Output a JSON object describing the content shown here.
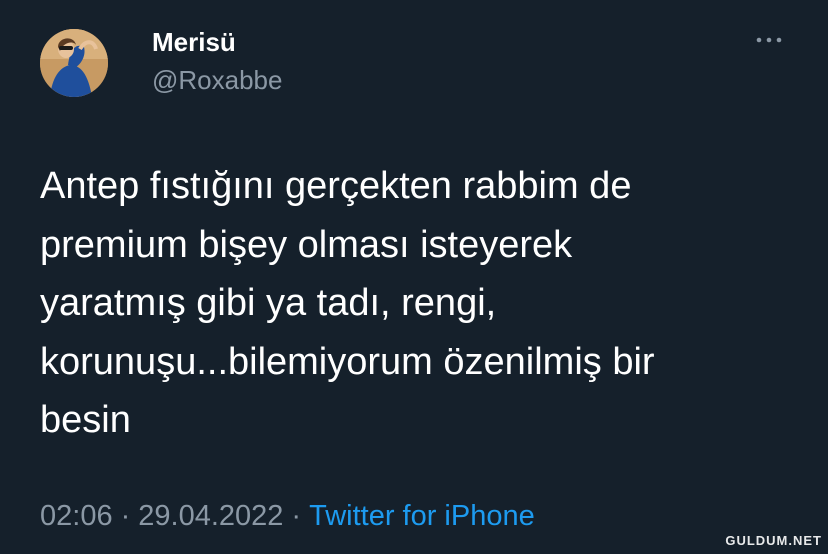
{
  "user": {
    "display_name": "Merisü",
    "username": "@Roxabbe"
  },
  "tweet": {
    "text": "Antep fıstığını gerçekten rabbim de\npremium bişey olması isteyerek\nyaratmış gibi ya tadı, rengi,\nkorunuşu...bilemiyorum özenilmiş bir\nbesin",
    "time": "02:06",
    "date": "29.04.2022",
    "separator": "·",
    "source": "Twitter for iPhone"
  },
  "icons": {
    "more": "more-horizontal-icon",
    "avatar": "profile-photo"
  },
  "colors": {
    "background": "#15202b",
    "primary_text": "#ffffff",
    "secondary_text": "#8b98a5",
    "link": "#1d9bf0"
  },
  "watermark": "GULDUM.NET"
}
